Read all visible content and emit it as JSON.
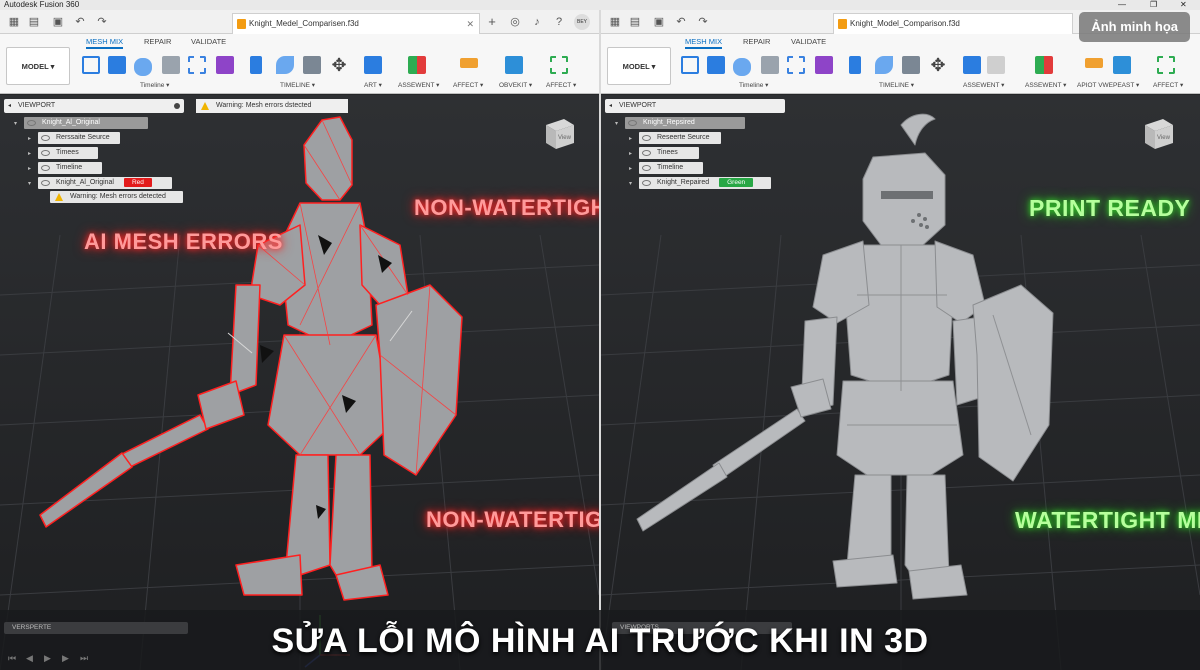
{
  "app": {
    "title": "Autodesk Fusion 360"
  },
  "window_controls": {
    "minimize": "—",
    "maximize": "❐",
    "close": "✕"
  },
  "colors": {
    "accent": "#0a6fc2",
    "error": "#e31b1b",
    "ok": "#28a745",
    "warn": "#f0b400"
  },
  "badge": {
    "label": "Ảnh minh họa"
  },
  "caption": {
    "text": "SỬA LỖI MÔ HÌNH AI TRƯỚC KHI IN 3D"
  },
  "left": {
    "doc_tab": "Knight_Medel_Comparisen.f3d",
    "user_initials": "BEY",
    "ribbon_tabs": [
      "MESH MIX",
      "REPAIR",
      "VALIDATE"
    ],
    "workspace": "MODEL",
    "group_labels": [
      "Timeline",
      "TIMELINE",
      "ART",
      "ASSEWENT",
      "AFFECT",
      "OBVEKIT",
      "AFFECT"
    ],
    "browser_title": "VIEWPORT",
    "warning_bar": "Warning: Mesh errors dstected",
    "tree": [
      {
        "label": "Knight_Al_Original",
        "tag": ""
      },
      {
        "label": "Rerssaite Seurce",
        "tag": ""
      },
      {
        "label": "Timees",
        "tag": ""
      },
      {
        "label": "Timeline",
        "tag": ""
      },
      {
        "label": "Knight_Al_Original",
        "tag": "Red"
      }
    ],
    "tree_warning": "Warning: Mesh errors detected",
    "viewcube": "View",
    "callouts": [
      "AI MESH ERRORS",
      "NON-WATERTIGHT",
      "NON-WATERTIGHT"
    ],
    "bottom_tab": "VERSPERTE"
  },
  "right": {
    "doc_tab": "Knight_Model_Comparison.f3d",
    "ribbon_tabs": [
      "MESH MIX",
      "REPAIR",
      "VALIDATE"
    ],
    "workspace": "MODEL",
    "group_labels": [
      "Timeline",
      "TIMELINE",
      "ASSEWENT",
      "ASSEWENT",
      "APIOT VWEPEAST",
      "AFFECT"
    ],
    "browser_title": "VIEWPORT",
    "tree": [
      {
        "label": "Knight_Repsired",
        "tag": ""
      },
      {
        "label": "Reseerte Seurce",
        "tag": ""
      },
      {
        "label": "Tinees",
        "tag": ""
      },
      {
        "label": "Timeline",
        "tag": ""
      },
      {
        "label": "Knight_Repaired",
        "tag": "Green"
      }
    ],
    "viewcube": "View",
    "callouts": [
      "PRINT READY",
      "WATERTIGHT MESH"
    ],
    "bottom_tab": "VIEWPORTS"
  }
}
